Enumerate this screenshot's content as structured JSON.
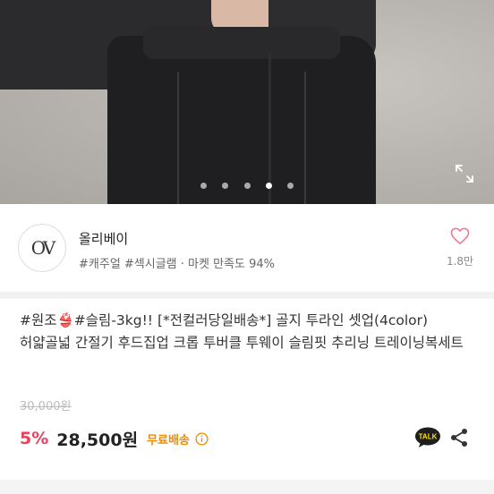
{
  "gallery": {
    "dots": [
      "",
      "",
      "",
      "",
      ""
    ],
    "active_index": 3
  },
  "seller": {
    "logo_text": "OV",
    "name": "올리베이",
    "tags": "#캐주얼 #섹시글램 · 마켓 만족도 94%",
    "likes": "1.8만"
  },
  "product": {
    "title": "#원조👙#슬림-3kg!! [*전컬러당일배송*] 골지 투라인 셋업(4color) 허얇골넓 간절기 후드집업 크롭 투버클 투웨이 슬림핏 추리닝 트레이닝복세트",
    "original_price": "30,000원",
    "discount": "5%",
    "price": "28,500원",
    "shipping": "무료배송",
    "talk_label": "TALK"
  },
  "colors": {
    "discount": "#f03f5c",
    "shipping": "#f08a00",
    "heart": "#f07b96"
  }
}
